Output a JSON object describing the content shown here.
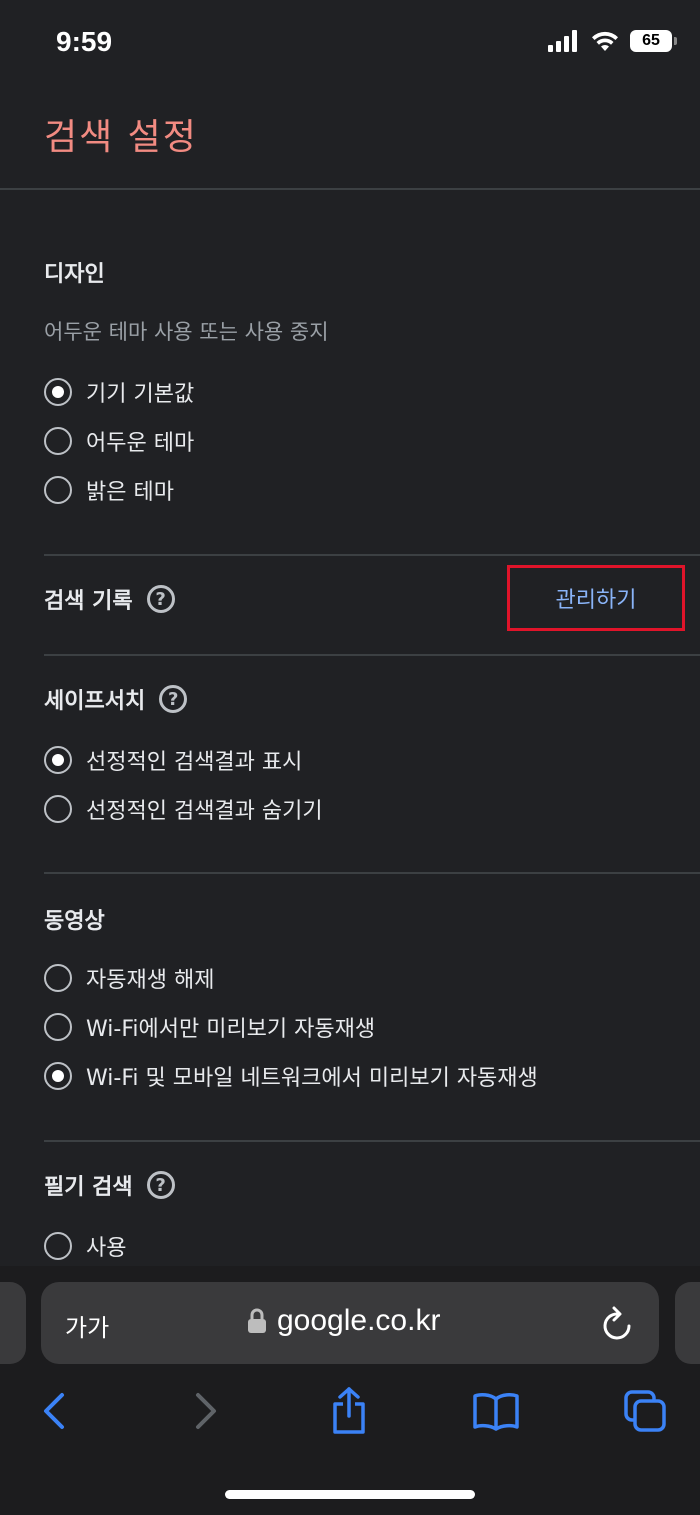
{
  "status": {
    "time": "9:59",
    "battery": "65"
  },
  "page": {
    "title": "검색 설정"
  },
  "design": {
    "title": "디자인",
    "description": "어두운 테마 사용 또는 사용 중지",
    "options": [
      "기기 기본값",
      "어두운 테마",
      "밝은 테마"
    ],
    "selected": 0
  },
  "history": {
    "title": "검색 기록",
    "manage_label": "관리하기"
  },
  "safesearch": {
    "title": "세이프서치",
    "options": [
      "선정적인 검색결과 표시",
      "선정적인 검색결과 숨기기"
    ],
    "selected": 0
  },
  "video": {
    "title": "동영상",
    "options": [
      "자동재생 해제",
      "Wi-Fi에서만 미리보기 자동재생",
      "Wi-Fi 및 모바일 네트워크에서 미리보기 자동재생"
    ],
    "selected": 2
  },
  "handwriting": {
    "title": "필기 검색",
    "options": [
      "사용"
    ]
  },
  "browser": {
    "text_size_label": "가가",
    "url": "google.co.kr"
  },
  "icons": {
    "back": "chevron-left-icon",
    "forward": "chevron-right-icon",
    "share": "share-icon",
    "bookmarks": "book-icon",
    "tabs": "tabs-icon",
    "lock": "lock-icon",
    "reload": "reload-icon"
  },
  "colors": {
    "background": "#202124",
    "title": "#f28b82",
    "link": "#8ab4f8",
    "highlight_box": "#e0142a",
    "ios_blue": "#3b82f6"
  }
}
